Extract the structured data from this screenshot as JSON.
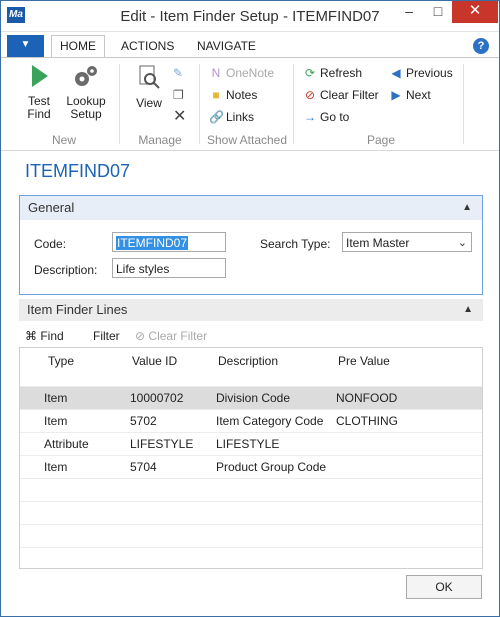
{
  "window": {
    "title": "Edit - Item Finder Setup - ITEMFIND07",
    "app_icon": "Ma",
    "minimize": "–",
    "maximize": "□",
    "close": "✕"
  },
  "ribbon": {
    "file_tab": "▼",
    "tabs": [
      "HOME",
      "ACTIONS",
      "NAVIGATE"
    ],
    "help": "?",
    "groups": {
      "new": {
        "label": "New",
        "test_find": "Test Find",
        "lookup_setup": "Lookup Setup"
      },
      "manage": {
        "label": "Manage",
        "view": "View"
      },
      "show_attached": {
        "label": "Show Attached",
        "onenote": "OneNote",
        "notes": "Notes",
        "links": "Links"
      },
      "page": {
        "label": "Page",
        "refresh": "Refresh",
        "clear_filter": "Clear Filter",
        "go_to": "Go to",
        "previous": "Previous",
        "next": "Next"
      }
    }
  },
  "page_title": "ITEMFIND07",
  "general": {
    "header": "General",
    "code_label": "Code:",
    "code_value": "ITEMFIND07",
    "description_label": "Description:",
    "description_value": "Life styles",
    "search_type_label": "Search Type:",
    "search_type_value": "Item Master"
  },
  "lines": {
    "header": "Item Finder Lines",
    "toolbar": {
      "find": "Find",
      "filter": "Filter",
      "clear_filter": "Clear Filter"
    },
    "columns": [
      "Type",
      "Value ID",
      "Description",
      "Pre Value"
    ],
    "rows": [
      {
        "type": "Item",
        "value_id": "10000702",
        "description": "Division Code",
        "pre_value": "NONFOOD"
      },
      {
        "type": "Item",
        "value_id": "5702",
        "description": "Item Category Code",
        "pre_value": "CLOTHING"
      },
      {
        "type": "Attribute",
        "value_id": "LIFESTYLE",
        "description": "LIFESTYLE",
        "pre_value": ""
      },
      {
        "type": "Item",
        "value_id": "5704",
        "description": "Product Group Code",
        "pre_value": ""
      }
    ]
  },
  "ok_button": "OK",
  "colors": {
    "accent": "#1c63b7",
    "close_red": "#c7352b",
    "selection": "#3390e3",
    "selected_row": "#dcdcdc"
  }
}
